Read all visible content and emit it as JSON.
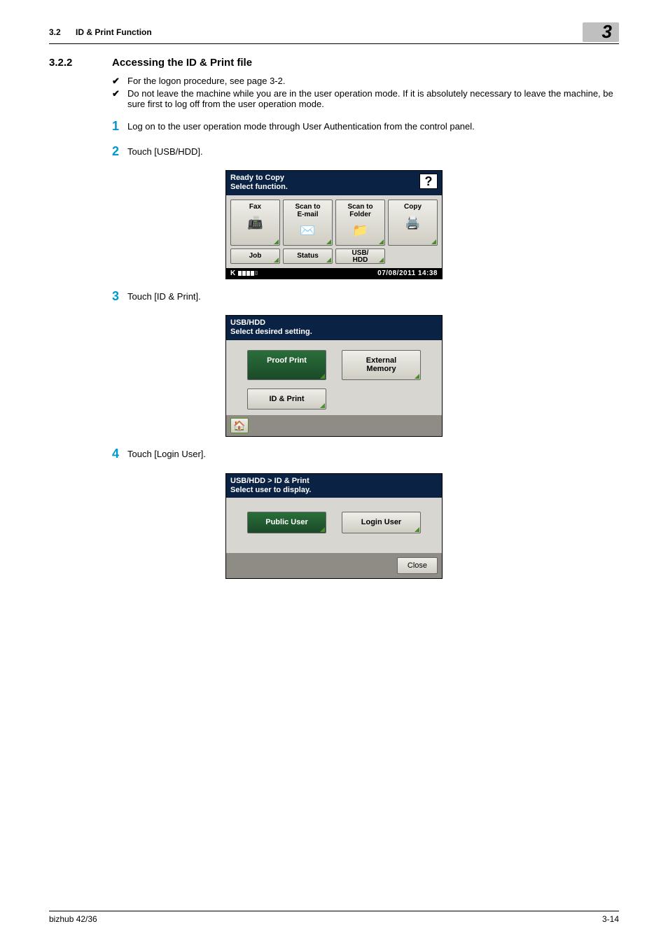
{
  "header": {
    "section_num": "3.2",
    "section_title": "ID & Print Function",
    "chapter": "3"
  },
  "heading": {
    "num": "3.2.2",
    "title": "Accessing the ID & Print file"
  },
  "checks": [
    "For the logon procedure, see page 3-2.",
    "Do not leave the machine while you are in the user operation mode. If it is absolutely necessary to leave the machine, be sure first to log off from the user operation mode."
  ],
  "steps": {
    "s1": {
      "num": "1",
      "text": "Log on to the user operation mode through User Authentication from the control panel."
    },
    "s2": {
      "num": "2",
      "text": "Touch [USB/HDD]."
    },
    "s3": {
      "num": "3",
      "text": "Touch [ID & Print]."
    },
    "s4": {
      "num": "4",
      "text": "Touch [Login User]."
    }
  },
  "screen1": {
    "title": "Ready to Copy",
    "subtitle": "Select function.",
    "help": "?",
    "buttons": {
      "fax": "Fax",
      "scan_email": "Scan to\nE-mail",
      "scan_folder": "Scan to\nFolder",
      "copy": "Copy",
      "job": "Job",
      "status": "Status",
      "usb_hdd": "USB/\nHDD"
    },
    "toner_label": "K",
    "datetime": "07/08/2011  14:38"
  },
  "screen2": {
    "title": "USB/HDD",
    "subtitle": "Select desired setting.",
    "buttons": {
      "proof_print": "Proof Print",
      "external_memory": "External\nMemory",
      "id_print": "ID & Print"
    }
  },
  "screen3": {
    "title": "USB/HDD > ID & Print",
    "subtitle": "Select user to display.",
    "buttons": {
      "public_user": "Public User",
      "login_user": "Login User"
    },
    "close": "Close"
  },
  "footer": {
    "left": "bizhub 42/36",
    "right": "3-14"
  }
}
